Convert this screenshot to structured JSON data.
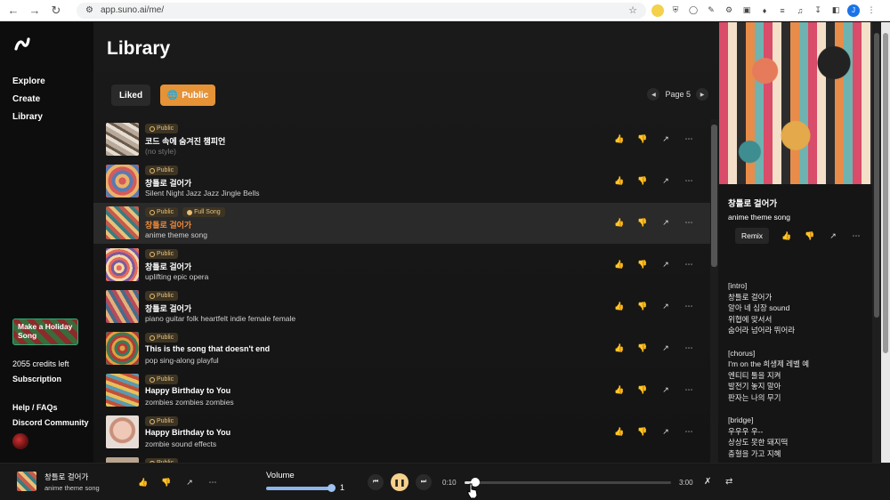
{
  "browser": {
    "url": "app.suno.ai/me/",
    "profile_initial": "J"
  },
  "sidebar": {
    "items": [
      {
        "label": "Explore"
      },
      {
        "label": "Create"
      },
      {
        "label": "Library"
      }
    ],
    "holiday_button": "Make a Holiday Song",
    "credits": "2055 credits left",
    "subscription": "Subscription",
    "help": "Help / FAQs",
    "discord": "Discord Community"
  },
  "library": {
    "title": "Library",
    "tabs": {
      "liked": "Liked",
      "public": "Public"
    },
    "page_label": "Page 5",
    "badge_public": "Public",
    "badge_full_song": "Full Song",
    "songs": [
      {
        "title": "코드 속에 숨겨진 챔피언",
        "style": "(no style)"
      },
      {
        "title": "창틀로 걸어가",
        "style": "Silent Night Jazz Jazz Jingle Bells"
      },
      {
        "title": "창틀로 걸어가",
        "style": "anime theme song"
      },
      {
        "title": "창틀로 걸어가",
        "style": "uplifting epic opera"
      },
      {
        "title": "창틀로 걸어가",
        "style": "piano guitar folk heartfelt indie female female"
      },
      {
        "title": "This is the song that doesn't end",
        "style": "pop sing-along playful"
      },
      {
        "title": "Happy Birthday to You",
        "style": "zombies zombies zombies"
      },
      {
        "title": "Happy Birthday to You",
        "style": "zombie sound effects"
      },
      {
        "title": "",
        "style": ""
      }
    ]
  },
  "panel": {
    "title": "창틀로 걸어가",
    "style": "anime theme song",
    "remix_label": "Remix",
    "lyrics": "[intro]\n창틀로 걸어가\n알아 네 심장 sound\n위협에 맞서서\n숨어라 넘어라 뛰어라\n\n[chorus]\nI'm on the 희생제 레벨 예\n엔티티 툴을 지켜\n발전기 놓지 말아\n판자는 나의 무기\n\n[bridge]\n우우우 우--\n상상도 못한 돼지떡\n충혈을 가고 지혜"
  },
  "player": {
    "title": "창틀로 걸어가",
    "style": "anime theme song",
    "volume_label": "Volume",
    "volume_value": "1",
    "volume_level": 0.92,
    "current_time": "0:10",
    "total_time": "3:00",
    "progress": 0.056
  },
  "colors": {
    "accent": "#e69236",
    "highlight_title": "#ef8a37",
    "badge_bg": "#3d3423",
    "badge_text": "#e6c07a"
  }
}
